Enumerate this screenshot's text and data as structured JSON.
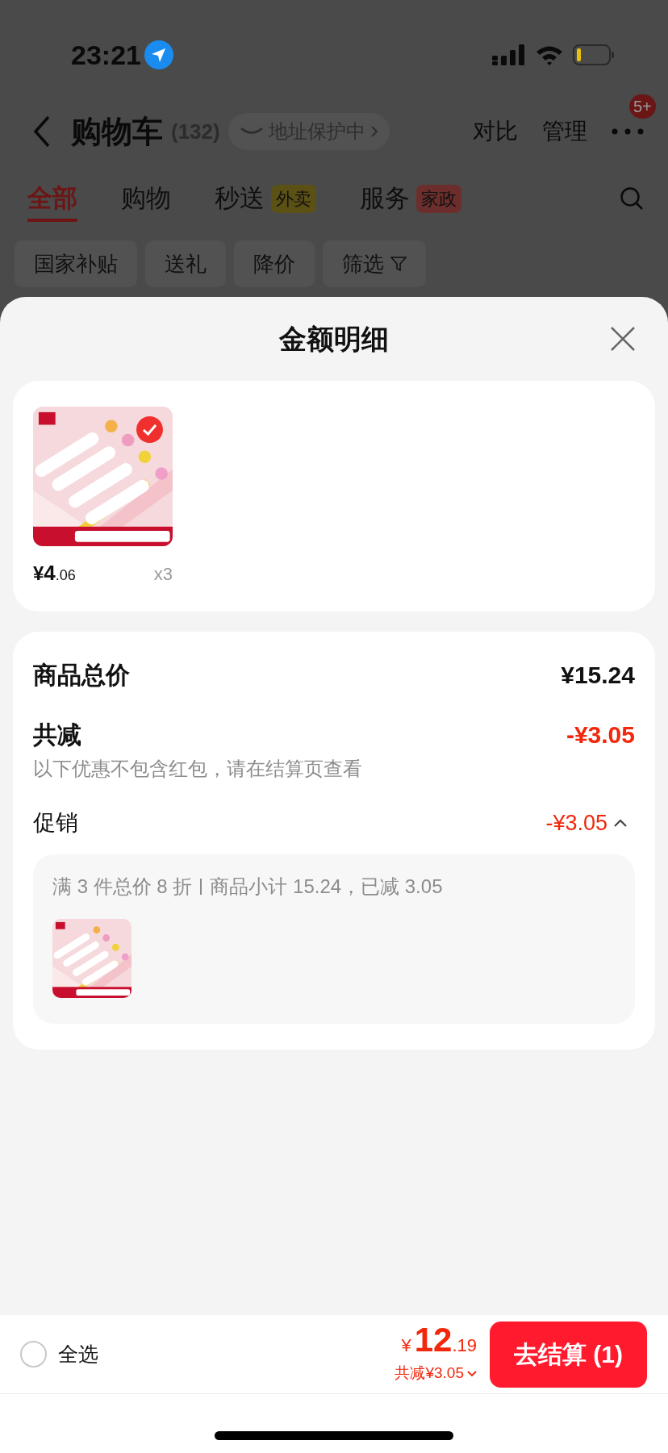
{
  "status_bar": {
    "time": "23:21"
  },
  "header": {
    "title": "购物车",
    "count": "(132)",
    "address_pill": "地址保护中",
    "actions": [
      "对比",
      "管理"
    ],
    "more_badge": "5+"
  },
  "tabs": [
    {
      "label": "全部",
      "selected": true
    },
    {
      "label": "购物",
      "selected": false
    },
    {
      "label": "秒送",
      "badge": "外卖",
      "color": "#5c5114",
      "selected": false
    },
    {
      "label": "服务",
      "badge": "家政",
      "color": "#6b2e2c",
      "selected": false
    }
  ],
  "filters": [
    {
      "label": "国家补贴",
      "kind": "chip"
    },
    {
      "label": "送礼",
      "kind": "chip"
    },
    {
      "label": "降价",
      "kind": "chip"
    },
    {
      "label": "筛选",
      "kind": "filter"
    }
  ],
  "sheet": {
    "title": "金额明细",
    "items": [
      {
        "kind": "picture",
        "checked": true,
        "price_currency": "¥",
        "price_main": "4",
        "price_cents": ".06",
        "quantity": "x3"
      }
    ],
    "summary": {
      "total_label": "商品总价",
      "total_value": "¥15.24",
      "reduction_label": "共减",
      "reduction_value": "-¥3.05",
      "note": "以下优惠不包含红包，请在结算页查看",
      "promo_label": "促销",
      "promo_value": "-¥3.05",
      "expanded": true,
      "promo_rule": "满 3 件总价 8 折",
      "promo_detail": "商品小计 15.24，已减 3.05"
    }
  },
  "bottom_bar": {
    "select_all": {
      "label": "全选",
      "checked": false
    },
    "total_currency": "¥",
    "total_main": "12",
    "total_cents": ".19",
    "saved": "共减¥3.05",
    "checkout": "去结算 (1)"
  }
}
